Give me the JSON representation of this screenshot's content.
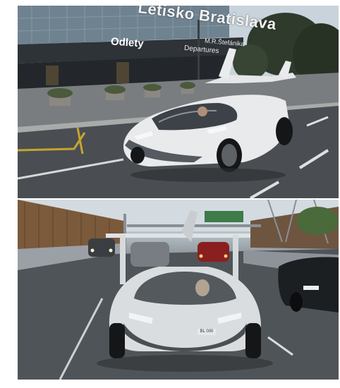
{
  "top_photo": {
    "sign_main": "Letisko Bratislava",
    "sign_departures_sk": "Odlety",
    "sign_departures_en": "Departures",
    "sign_address": "M.R.Štefánika"
  },
  "bottom_photo": {
    "plate": "BL 000"
  }
}
